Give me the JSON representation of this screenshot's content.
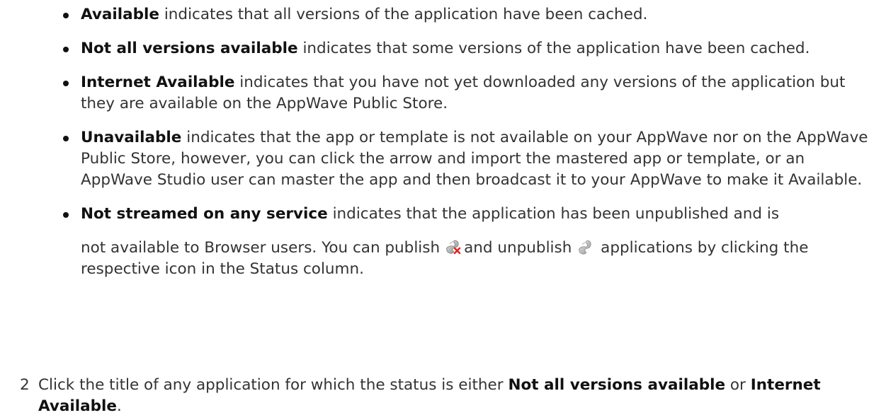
{
  "bullets": [
    {
      "term": "Available",
      "text": " indicates that all versions of the application have been cached."
    },
    {
      "term": "Not all versions available",
      "text": " indicates that some versions of the application have been cached."
    },
    {
      "term": "Internet Available",
      "text": " indicates that you have not yet downloaded any versions of the application but they are available on the AppWave Public Store."
    },
    {
      "term": "Unavailable",
      "text": " indicates that the app or template is not available on your AppWave nor on the AppWave Public Store, however, you can click the arrow and import the mastered app or template, or an AppWave Studio user can master the app and then broadcast it to your AppWave to make it Available."
    },
    {
      "term": "Not streamed on any service",
      "text": " indicates that the application has been unpublished and is",
      "text2_a": "not available to Browser users. You can publish",
      "text2_b": "and unpublish",
      "text2_c": " applications by clicking the respective icon in the Status column.",
      "icon_publish": "publish-icon",
      "icon_unpublish": "unpublish-icon"
    }
  ],
  "step": {
    "number": "2",
    "text_a": "Click the title of any application for which the status is either ",
    "term_a": "Not all versions available",
    "text_b": " or ",
    "term_b": "Internet Available",
    "text_c": "."
  }
}
